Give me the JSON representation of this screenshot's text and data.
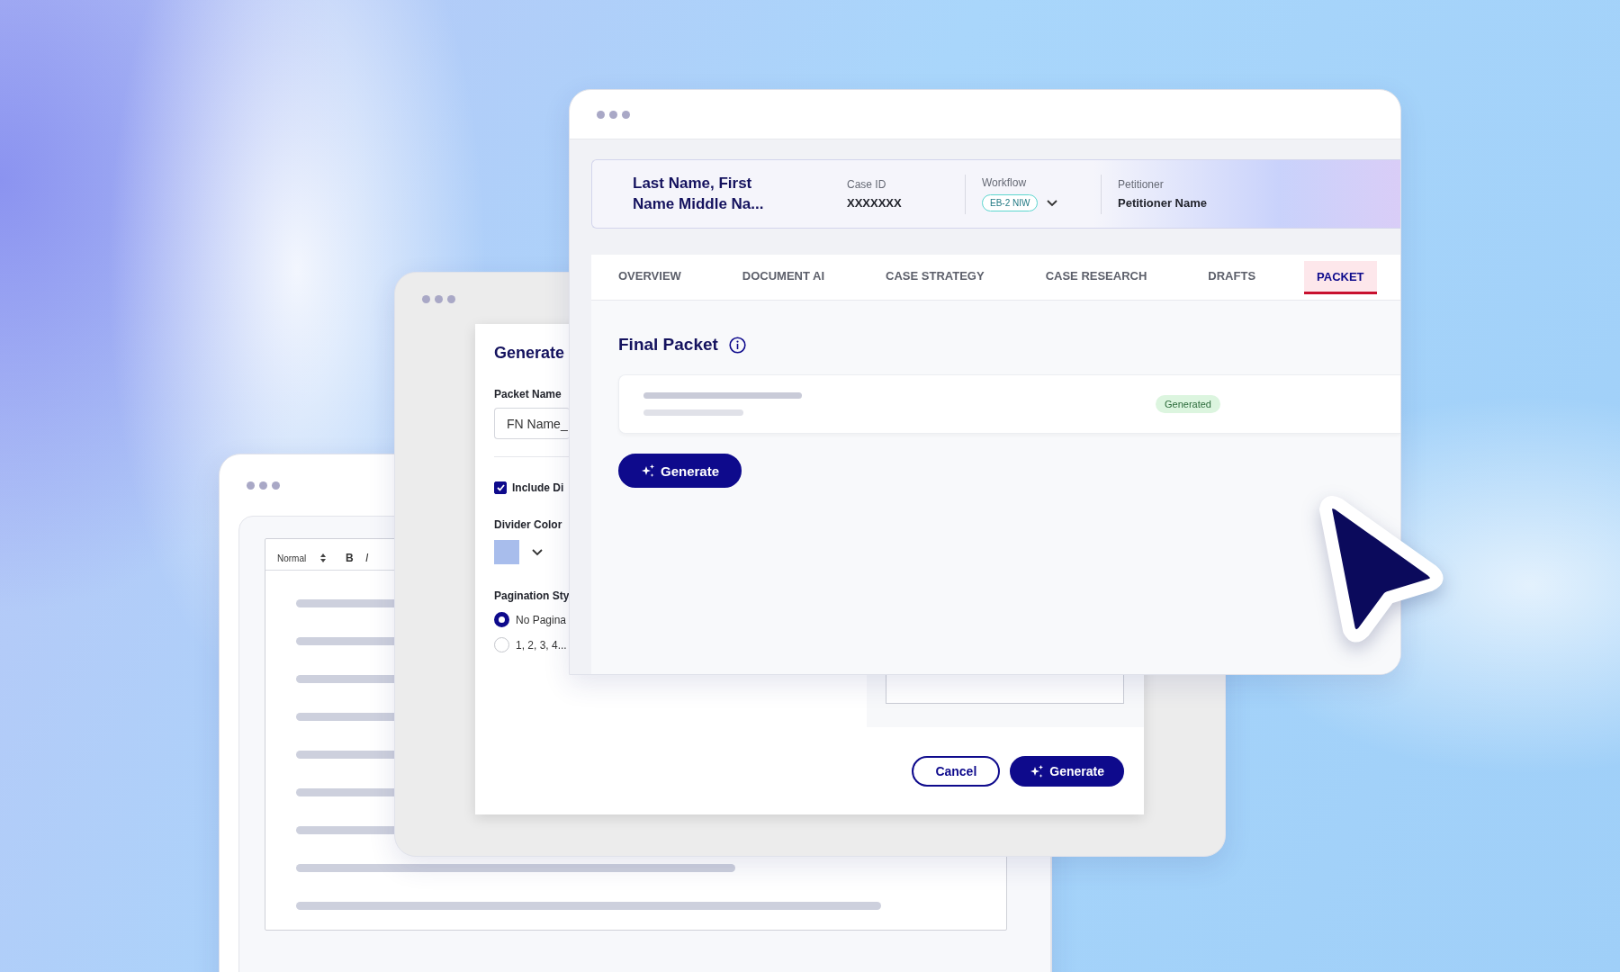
{
  "editor_window": {
    "toolbar": {
      "style": "Normal",
      "bold": "B",
      "italic": "I"
    }
  },
  "generate_dialog": {
    "title": "Generate",
    "packet_name_label": "Packet Name",
    "packet_name_value": "FN Name_",
    "include_dividers": {
      "label": "Include Di",
      "checked": true
    },
    "divider_color_label": "Divider Color",
    "pagination": {
      "label": "Pagination Sty",
      "options": [
        {
          "label": "No Pagina",
          "selected": true
        },
        {
          "label": "1, 2, 3, 4...",
          "selected": false
        }
      ]
    },
    "buttons": [
      {
        "label": "Cancel",
        "kind": "secondary"
      },
      {
        "label": "Generate",
        "kind": "primary"
      }
    ]
  },
  "case_window": {
    "case": {
      "name": "Last Name, First Name Middle Na...",
      "case_id_label": "Case ID",
      "case_id": "XXXXXXX",
      "workflow_label": "Workflow",
      "workflow": "EB-2 NIW",
      "petitioner_label": "Petitioner",
      "petitioner": "Petitioner Name"
    },
    "tabs": [
      {
        "label": "OVERVIEW",
        "selected": false
      },
      {
        "label": "DOCUMENT AI",
        "selected": false
      },
      {
        "label": "CASE STRATEGY",
        "selected": false
      },
      {
        "label": "CASE RESEARCH",
        "selected": false
      },
      {
        "label": "DRAFTS",
        "selected": false
      },
      {
        "label": "PACKET",
        "selected": true
      }
    ],
    "section_title": "Final Packet",
    "packet_status": "Generated",
    "generate_button": "Generate"
  }
}
